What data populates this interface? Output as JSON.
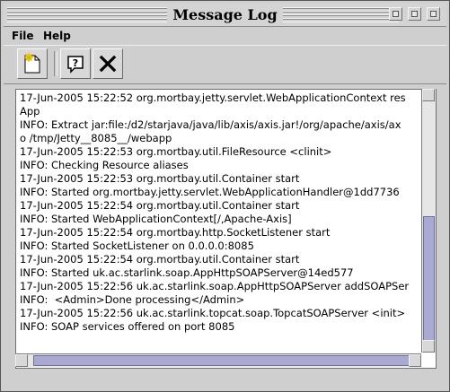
{
  "window": {
    "title": "Message Log"
  },
  "menu": {
    "file": "File",
    "help": "Help"
  },
  "toolbar": [
    {
      "name": "new-log-icon"
    },
    {
      "name": "help-icon"
    },
    {
      "name": "close-icon"
    }
  ],
  "log": {
    "lines": [
      "17-Jun-2005 15:22:52 org.mortbay.jetty.servlet.WebApplicationContext res",
      "App",
      "INFO: Extract jar:file:/d2/starjava/java/lib/axis/axis.jar!/org/apache/axis/ax",
      "o /tmp/Jetty__8085__/webapp",
      "17-Jun-2005 15:22:53 org.mortbay.util.FileResource <clinit>",
      "INFO: Checking Resource aliases",
      "17-Jun-2005 15:22:53 org.mortbay.util.Container start",
      "INFO: Started org.mortbay.jetty.servlet.WebApplicationHandler@1dd7736",
      "17-Jun-2005 15:22:54 org.mortbay.util.Container start",
      "INFO: Started WebApplicationContext[/,Apache-Axis]",
      "17-Jun-2005 15:22:54 org.mortbay.http.SocketListener start",
      "INFO: Started SocketListener on 0.0.0.0:8085",
      "17-Jun-2005 15:22:54 org.mortbay.util.Container start",
      "INFO: Started uk.ac.starlink.soap.AppHttpSOAPServer@14ed577",
      "17-Jun-2005 15:22:56 uk.ac.starlink.soap.AppHttpSOAPServer addSOAPSer",
      "INFO:  <Admin>Done processing</Admin>",
      "17-Jun-2005 15:22:56 uk.ac.starlink.topcat.soap.TopcatSOAPServer <init>",
      "INFO: SOAP services offered on port 8085"
    ]
  }
}
